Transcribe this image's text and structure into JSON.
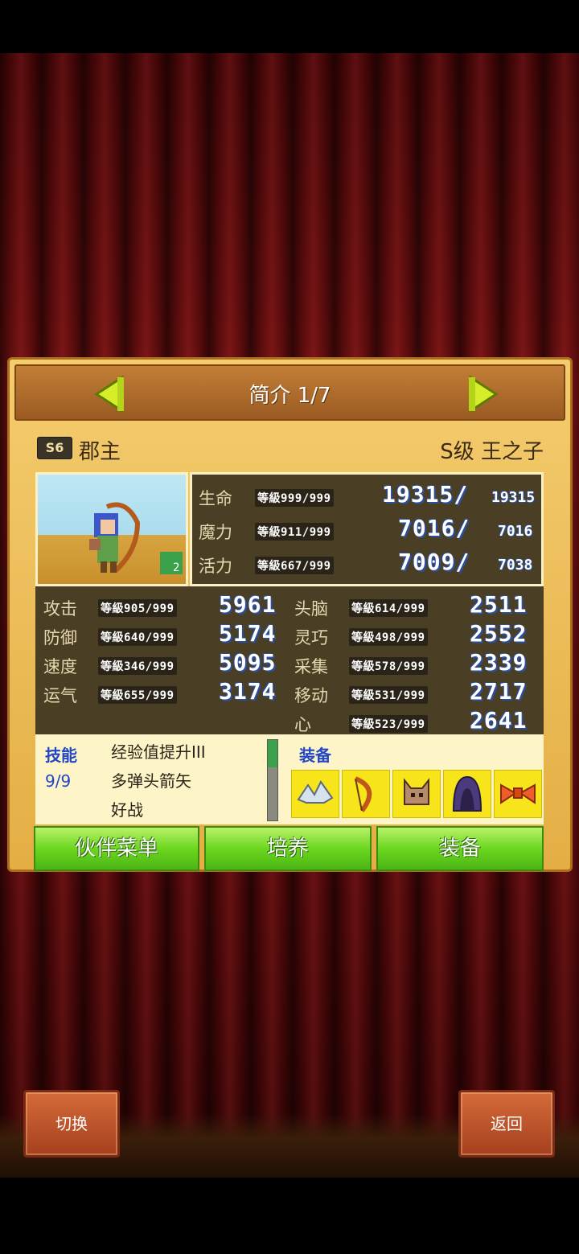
{
  "header": {
    "title": "简介 1/7"
  },
  "character": {
    "rank": "S6",
    "name": "郡主",
    "class": "S级 王之子",
    "party_badge": "2"
  },
  "top_stats": [
    {
      "label": "生命",
      "level": "等級999/999",
      "current": "19315/",
      "max": "19315"
    },
    {
      "label": "魔力",
      "level": "等級911/999",
      "current": "7016/",
      "max": "7016"
    },
    {
      "label": "活力",
      "level": "等級667/999",
      "current": "7009/",
      "max": "7038"
    }
  ],
  "left_stats": [
    {
      "label": "攻击",
      "level": "等級905/999",
      "value": "5961"
    },
    {
      "label": "防御",
      "level": "等級640/999",
      "value": "5174"
    },
    {
      "label": "速度",
      "level": "等級346/999",
      "value": "5095"
    },
    {
      "label": "运气",
      "level": "等級655/999",
      "value": "3174"
    }
  ],
  "right_stats": [
    {
      "label": "头脑",
      "level": "等級614/999",
      "value": "2511"
    },
    {
      "label": "灵巧",
      "level": "等級498/999",
      "value": "2552"
    },
    {
      "label": "采集",
      "level": "等級578/999",
      "value": "2339"
    },
    {
      "label": "移动",
      "level": "等級531/999",
      "value": "2717"
    },
    {
      "label": "心",
      "level": "等級523/999",
      "value": "2641"
    }
  ],
  "skills": {
    "title": "技能",
    "count": "9/9",
    "items": [
      "经验值提升III",
      "多弹头箭矢",
      "好战"
    ]
  },
  "equipment": {
    "title": "装备",
    "items": [
      "wing-helm-icon",
      "bow-icon",
      "cat-mask-icon",
      "hood-icon",
      "ribbon-icon"
    ]
  },
  "buttons": {
    "partner_menu": "伙伴菜单",
    "train": "培养",
    "equip": "装备"
  },
  "bottom": {
    "switch": "切换",
    "back": "返回"
  }
}
